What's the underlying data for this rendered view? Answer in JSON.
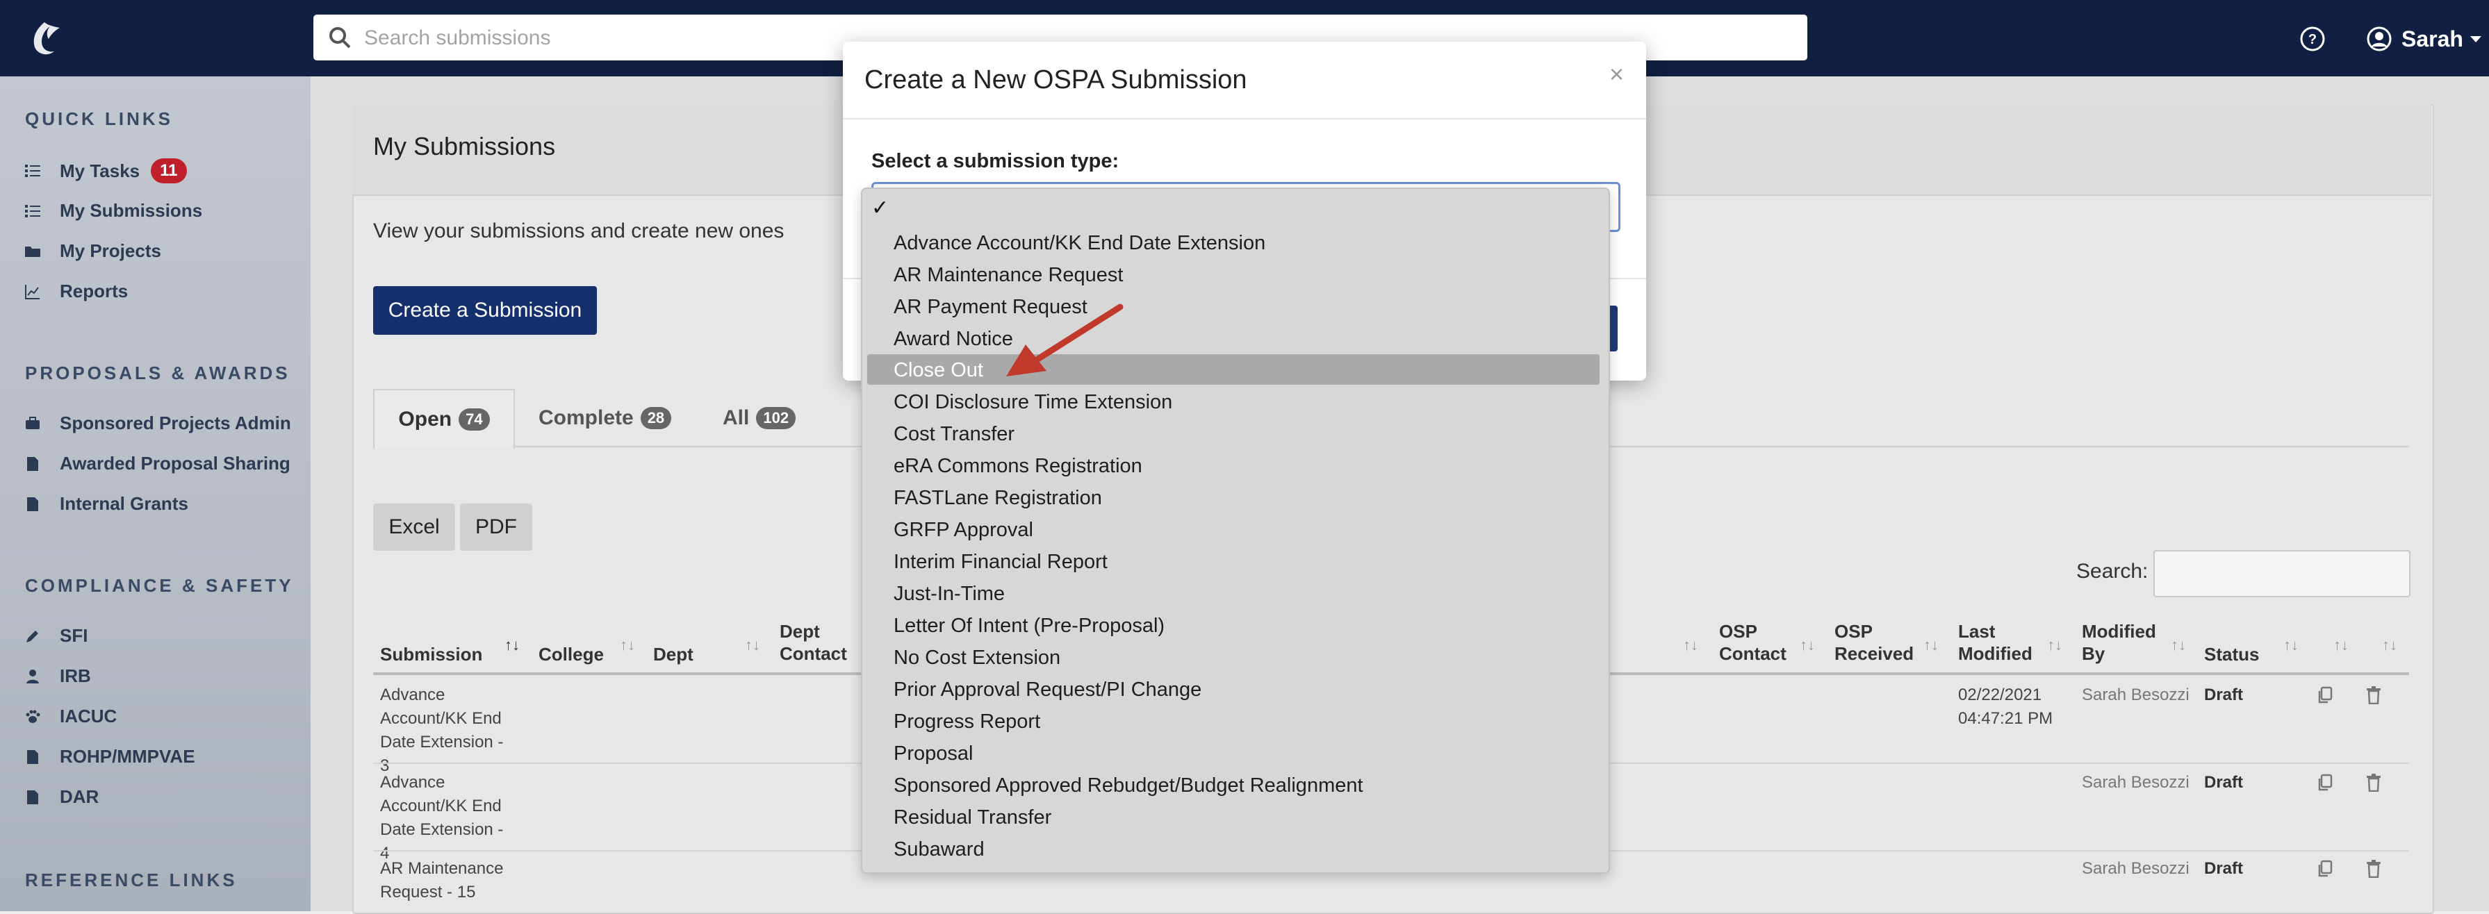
{
  "search": {
    "placeholder": "Search submissions"
  },
  "user": {
    "name": "Sarah"
  },
  "sidebar": {
    "sections": [
      {
        "heading": "QUICK LINKS",
        "items": [
          {
            "label": "My Tasks",
            "badge": "11",
            "icon": "list-icon"
          },
          {
            "label": "My Submissions",
            "icon": "list-icon"
          },
          {
            "label": "My Projects",
            "icon": "folder-icon"
          },
          {
            "label": "Reports",
            "icon": "chart-icon"
          }
        ]
      },
      {
        "heading": "PROPOSALS & AWARDS",
        "items": [
          {
            "label": "Sponsored Projects Admin",
            "icon": "briefcase-icon"
          },
          {
            "label": "Awarded Proposal Sharing",
            "icon": "document-icon"
          },
          {
            "label": "Internal Grants",
            "icon": "document-icon"
          }
        ]
      },
      {
        "heading": "COMPLIANCE & SAFETY",
        "items": [
          {
            "label": "SFI",
            "icon": "edit-icon"
          },
          {
            "label": "IRB",
            "icon": "user-icon"
          },
          {
            "label": "IACUC",
            "icon": "paw-icon"
          },
          {
            "label": "ROHP/MMPVAE",
            "icon": "document-icon"
          },
          {
            "label": "DAR",
            "icon": "document-icon"
          }
        ]
      },
      {
        "heading": "REFERENCE LINKS",
        "items": []
      }
    ]
  },
  "main": {
    "title": "My Submissions",
    "description": "View your submissions and create new ones",
    "create_button": "Create a Submission",
    "tabs": [
      {
        "label": "Open",
        "count": "74"
      },
      {
        "label": "Complete",
        "count": "28"
      },
      {
        "label": "All",
        "count": "102"
      }
    ],
    "export_buttons": [
      "Excel",
      "PDF"
    ],
    "search_label": "Search:",
    "columns": [
      "Submission",
      "College",
      "Dept",
      "Dept Contact",
      "OSP Contact",
      "OSP Received",
      "Last Modified",
      "Modified By",
      "Status"
    ],
    "rows": [
      {
        "submission": "Advance Account/KK End Date Extension - 3",
        "last_modified": "02/22/2021 04:47:21 PM",
        "modified_by": "Sarah Besozzi",
        "status": "Draft"
      },
      {
        "submission": "Advance Account/KK End Date Extension - 4",
        "last_modified": "",
        "modified_by": "Sarah Besozzi",
        "status": "Draft"
      },
      {
        "submission": "AR Maintenance Request - 15",
        "last_modified": "",
        "modified_by": "Sarah Besozzi",
        "status": "Draft"
      }
    ]
  },
  "modal": {
    "title": "Create a New OSPA Submission",
    "close": "×",
    "select_label": "Select a submission type:",
    "selected_check": "✓",
    "options": [
      "Advance Account/KK End Date Extension",
      "AR Maintenance Request",
      "AR Payment Request",
      "Award Notice",
      "Close Out",
      "COI Disclosure Time Extension",
      "Cost Transfer",
      "eRA Commons Registration",
      "FASTLane Registration",
      "GRFP Approval",
      "Interim Financial Report",
      "Just-In-Time",
      "Letter Of Intent (Pre-Proposal)",
      "No Cost Extension",
      "Prior Approval Request/PI Change",
      "Progress Report",
      "Proposal",
      "Sponsored Approved Rebudget/Budget Realignment",
      "Residual Transfer",
      "Subaward"
    ],
    "highlighted_option": "Close Out"
  },
  "colors": {
    "nav": "#112042",
    "accent": "#142f6b",
    "badge": "#c0202b",
    "annotation_arrow": "#c0392b"
  }
}
